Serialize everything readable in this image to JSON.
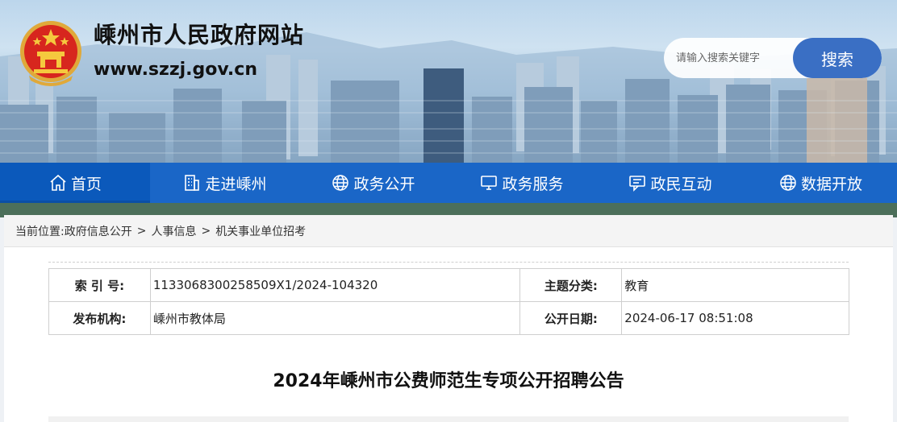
{
  "site": {
    "title": "嵊州市人民政府网站",
    "url": "www.szzj.gov.cn"
  },
  "search": {
    "placeholder": "请输入搜索关键字",
    "button_label": "搜索"
  },
  "nav": {
    "items": [
      {
        "label": "首页",
        "icon": "home-icon",
        "active": true
      },
      {
        "label": "走进嵊州",
        "icon": "building-icon",
        "active": false
      },
      {
        "label": "政务公开",
        "icon": "globe-icon",
        "active": false
      },
      {
        "label": "政务服务",
        "icon": "monitor-icon",
        "active": false
      },
      {
        "label": "政民互动",
        "icon": "chat-icon",
        "active": false
      },
      {
        "label": "数据开放",
        "icon": "globe-icon",
        "active": false
      }
    ]
  },
  "breadcrumb": {
    "prefix": "当前位置:",
    "items": [
      "政府信息公开",
      "人事信息",
      "机关事业单位招考"
    ],
    "separator": ">"
  },
  "meta": {
    "index_label": "索 引 号:",
    "index_value": "1133068300258509X1/2024-104320",
    "category_label": "主题分类:",
    "category_value": "教育",
    "publisher_label": "发布机构:",
    "publisher_value": "嵊州市教体局",
    "date_label": "公开日期:",
    "date_value": "2024-06-17 08:51:08"
  },
  "article": {
    "title": "2024年嵊州市公费师范生专项公开招聘公告"
  },
  "colors": {
    "nav_bg": "#1a66c7",
    "nav_active": "#0b59bb",
    "search_button": "#3a6fc4"
  }
}
